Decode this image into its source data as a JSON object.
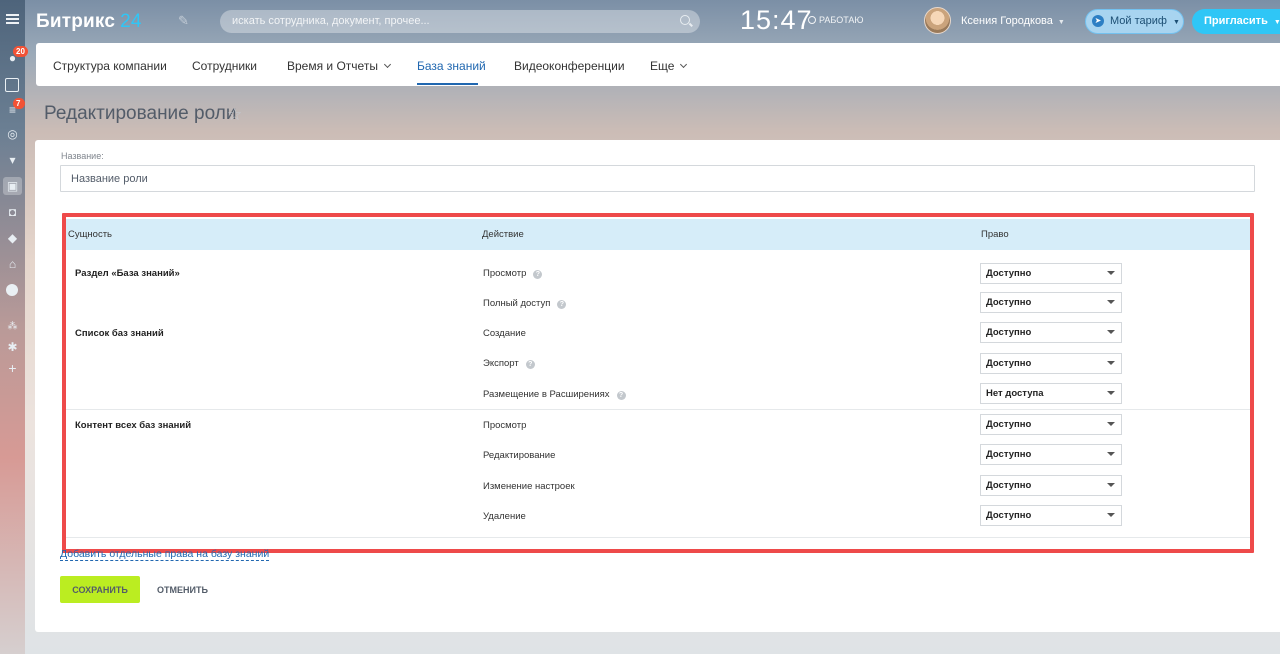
{
  "header": {
    "logo_text": "Битрикс",
    "logo_num": "24",
    "search_placeholder": "искать сотрудника, документ, прочее...",
    "clock": "15:47",
    "work_status": "РАБОТАЮ",
    "user_name": "Ксения Городкова",
    "tariff_label": "Мой тариф",
    "invite_label": "Пригласить"
  },
  "rail": {
    "badge_chat": "20",
    "badge_tasks": "7"
  },
  "menu": {
    "items": [
      {
        "label": "Структура компании"
      },
      {
        "label": "Сотрудники"
      },
      {
        "label": "Время и Отчеты"
      },
      {
        "label": "База знаний"
      },
      {
        "label": "Видеоконференции"
      },
      {
        "label": "Еще"
      }
    ]
  },
  "page": {
    "title": "Редактирование роли",
    "name_label": "Название:",
    "name_placeholder": "Название роли"
  },
  "table": {
    "headers": [
      "Сущность",
      "Действие",
      "Право"
    ],
    "entities": [
      "Раздел «База знаний»",
      "Список баз знаний",
      "Контент всех баз знаний"
    ],
    "rows": [
      {
        "action": "Просмотр",
        "help": true,
        "right": "Доступно"
      },
      {
        "action": "Полный доступ",
        "help": true,
        "right": "Доступно"
      },
      {
        "action": "Создание",
        "help": false,
        "right": "Доступно"
      },
      {
        "action": "Экспорт",
        "help": true,
        "right": "Доступно"
      },
      {
        "action": "Размещение в Расширениях",
        "help": true,
        "right": "Нет доступа"
      },
      {
        "action": "Просмотр",
        "help": false,
        "right": "Доступно"
      },
      {
        "action": "Редактирование",
        "help": false,
        "right": "Доступно"
      },
      {
        "action": "Изменение настроек",
        "help": false,
        "right": "Доступно"
      },
      {
        "action": "Удаление",
        "help": false,
        "right": "Доступно"
      }
    ]
  },
  "actions": {
    "add_link": "Добавить отдельные права на базу знаний",
    "save": "СОХРАНИТЬ",
    "cancel": "ОТМЕНИТЬ"
  },
  "colors": {
    "accent": "#2fc6f6",
    "link": "#2067b0",
    "save_button": "#bbed21",
    "highlight_border": "#ee4a4a",
    "table_header": "#d6edf9"
  }
}
